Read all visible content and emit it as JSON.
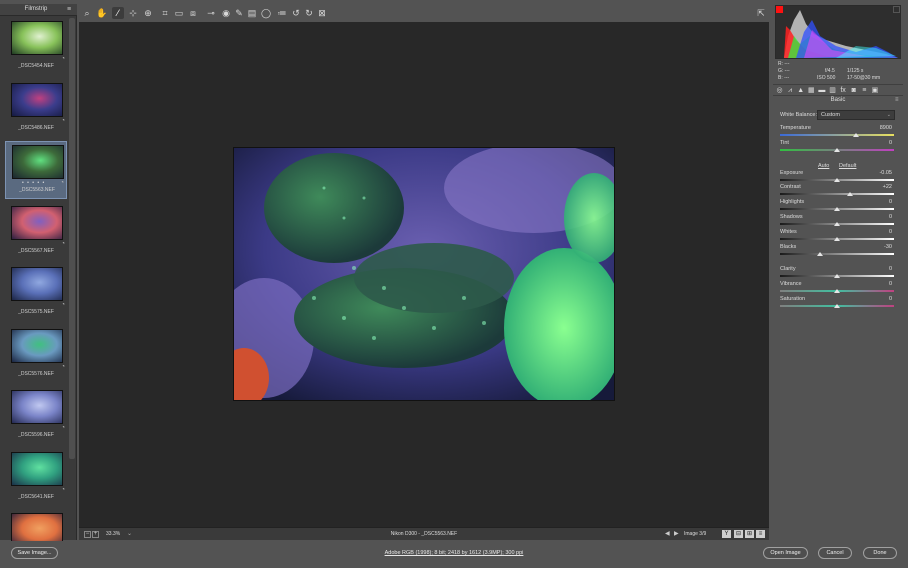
{
  "filmstrip": {
    "title": "Filmstrip",
    "menu_icon": "menu-icon",
    "items": [
      {
        "label": "_DSC5454.NEF",
        "colors": [
          "#1f3a22",
          "#88c25a",
          "#e0f0d0"
        ]
      },
      {
        "label": "_DSC5486.NEF",
        "colors": [
          "#151a40",
          "#3b3d8c",
          "#c04080"
        ]
      },
      {
        "label": "_DSC5563.NEF",
        "colors": [
          "#1a2530",
          "#3d6a3a",
          "#60e080"
        ],
        "selected": true,
        "rating": "• • • • •"
      },
      {
        "label": "_DSC5567.NEF",
        "colors": [
          "#2b1f40",
          "#d26070",
          "#8060c0"
        ]
      },
      {
        "label": "_DSC5575.NEF",
        "colors": [
          "#1b2444",
          "#5a70b8",
          "#90a8e0"
        ]
      },
      {
        "label": "_DSC5576.NEF",
        "colors": [
          "#1a2440",
          "#6a9ac0",
          "#40c080"
        ]
      },
      {
        "label": "_DSC5596.NEF",
        "colors": [
          "#232850",
          "#7a84c8",
          "#c0c8f0"
        ]
      },
      {
        "label": "_DSC5641.NEF",
        "colors": [
          "#1b3048",
          "#30a080",
          "#60e0a0"
        ]
      },
      {
        "label": "",
        "colors": [
          "#201a3a",
          "#e07040",
          "#f0a060"
        ]
      }
    ]
  },
  "toolbar": {
    "tools": [
      "zoom-icon",
      "hand-icon",
      "white-balance-icon",
      "color-sampler-icon",
      "targeted-adjust-icon",
      "crop-icon",
      "straighten-icon",
      "transform-icon",
      "spot-removal-icon",
      "red-eye-icon",
      "adjustment-brush-icon",
      "graduated-filter-icon",
      "radial-filter-icon",
      "preferences-icon",
      "rotate-ccw-icon",
      "rotate-cw-icon",
      "trash-icon"
    ],
    "glyphs": [
      "⌕",
      "✋",
      "⁄",
      "⊹",
      "⊕",
      "⌗",
      "▭",
      "⧈",
      "⊸",
      "◉",
      "✎",
      "▤",
      "◯",
      "≔",
      "↺",
      "↻",
      "⊠"
    ],
    "active_tool": "white-balance-icon",
    "fullscreen_icon": "fullscreen-icon"
  },
  "preview": {
    "photo_colors": [
      "#2a2460",
      "#3a3f8a",
      "#5a5aa8"
    ],
    "zoom_level": "33.3%",
    "filename": "Nikon D300  -  _DSC5563.NEF",
    "image_counter": "Image 3/9",
    "view_buttons": [
      "Y",
      "⊟",
      "⊞",
      "≡"
    ]
  },
  "histogram": {
    "colors": {
      "red": "#ff2020",
      "green": "#20ff40",
      "blue": "#3050ff",
      "luminance": "#e0e0e0"
    }
  },
  "readout": {
    "r_label": "R:",
    "r_value": "---",
    "g_label": "G:",
    "g_value": "---",
    "b_label": "B:",
    "b_value": "---",
    "aperture": "f/4.5",
    "shutter": "1/125 s",
    "iso": "ISO 500",
    "lens": "17-50@30 mm"
  },
  "panel": {
    "title": "Basic",
    "tabs": [
      "basic-icon",
      "tone-curve-icon",
      "detail-icon",
      "hsl-icon",
      "split-toning-icon",
      "lens-corrections-icon",
      "effects-icon",
      "camera-calibration-icon",
      "presets-icon",
      "snapshots-icon"
    ],
    "tab_glyphs": [
      "◎",
      "⩘",
      "▲",
      "▦",
      "▬",
      "▥",
      "fx",
      "◙",
      "≡",
      "▣"
    ],
    "white_balance_label": "White Balance:",
    "white_balance_value": "Custom",
    "auto_label": "Auto",
    "default_label": "Default",
    "sliders": [
      {
        "label": "Temperature",
        "value": "8900",
        "pos": 0.67,
        "gradient": "linear-gradient(90deg,#3a6ad8,#e8e060)"
      },
      {
        "label": "Tint",
        "value": "0",
        "pos": 0.5,
        "gradient": "linear-gradient(90deg,#30c040,#c040c0)"
      },
      {
        "label": "Exposure",
        "value": "-0.05",
        "pos": 0.5,
        "gradient": "linear-gradient(90deg,#1a1a1a,#ffffff)"
      },
      {
        "label": "Contrast",
        "value": "+22",
        "pos": 0.61,
        "gradient": "linear-gradient(90deg,#1a1a1a,#ffffff)"
      },
      {
        "label": "Highlights",
        "value": "0",
        "pos": 0.5,
        "gradient": "linear-gradient(90deg,#1a1a1a,#ffffff)"
      },
      {
        "label": "Shadows",
        "value": "0",
        "pos": 0.5,
        "gradient": "linear-gradient(90deg,#1a1a1a,#ffffff)"
      },
      {
        "label": "Whites",
        "value": "0",
        "pos": 0.5,
        "gradient": "linear-gradient(90deg,#1a1a1a,#ffffff)"
      },
      {
        "label": "Blacks",
        "value": "-30",
        "pos": 0.35,
        "gradient": "linear-gradient(90deg,#1a1a1a,#ffffff)"
      },
      {
        "label": "Clarity",
        "value": "0",
        "pos": 0.5,
        "gradient": "linear-gradient(90deg,#1a1a1a,#ffffff)"
      },
      {
        "label": "Vibrance",
        "value": "0",
        "pos": 0.5,
        "gradient": "linear-gradient(90deg,#808080,#40c0a0,#c04080)"
      },
      {
        "label": "Saturation",
        "value": "0",
        "pos": 0.5,
        "gradient": "linear-gradient(90deg,#808080,#40c0a0,#c04080)"
      }
    ]
  },
  "footer": {
    "save_label": "Save Image...",
    "workflow_label": "Adobe RGB (1998); 8 bit; 2418 by 1612 (3.9MP); 300 ppi",
    "open_label": "Open Image",
    "cancel_label": "Cancel",
    "done_label": "Done"
  }
}
